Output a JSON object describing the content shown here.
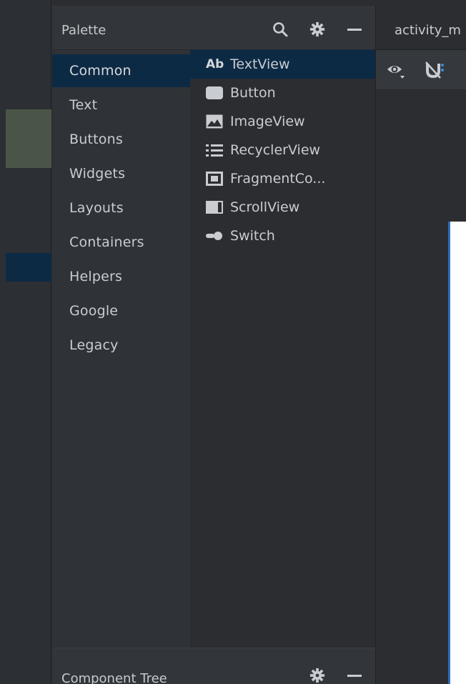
{
  "palette": {
    "title": "Palette",
    "header_icons": [
      "search-icon",
      "gear-icon",
      "minimize-icon"
    ],
    "categories": [
      {
        "label": "Common",
        "selected": true
      },
      {
        "label": "Text",
        "selected": false
      },
      {
        "label": "Buttons",
        "selected": false
      },
      {
        "label": "Widgets",
        "selected": false
      },
      {
        "label": "Layouts",
        "selected": false
      },
      {
        "label": "Containers",
        "selected": false
      },
      {
        "label": "Helpers",
        "selected": false
      },
      {
        "label": "Google",
        "selected": false
      },
      {
        "label": "Legacy",
        "selected": false
      }
    ],
    "items": [
      {
        "label": "TextView",
        "icon": "Ab",
        "icon_name": "textview-icon",
        "selected": true
      },
      {
        "label": "Button",
        "icon_name": "button-icon",
        "selected": false
      },
      {
        "label": "ImageView",
        "icon_name": "imageview-icon",
        "selected": false
      },
      {
        "label": "RecyclerView",
        "icon_name": "recyclerview-icon",
        "selected": false
      },
      {
        "label": "FragmentCo...",
        "icon_name": "fragmentcontainer-icon",
        "selected": false
      },
      {
        "label": "ScrollView",
        "icon_name": "scrollview-icon",
        "selected": false
      },
      {
        "label": "Switch",
        "icon_name": "switch-icon",
        "selected": false
      }
    ]
  },
  "component_tree": {
    "title": "Component Tree"
  },
  "editor": {
    "tab_label": "activity_m",
    "toolbar_icons": [
      "eye-icon",
      "magnet-icon"
    ]
  },
  "colors": {
    "selected_bg": "#0d2a45",
    "panel_bg": "#2b2d30",
    "header_bg": "#323539",
    "text": "#c9ccd0",
    "accent_blue": "#2f6db3"
  }
}
